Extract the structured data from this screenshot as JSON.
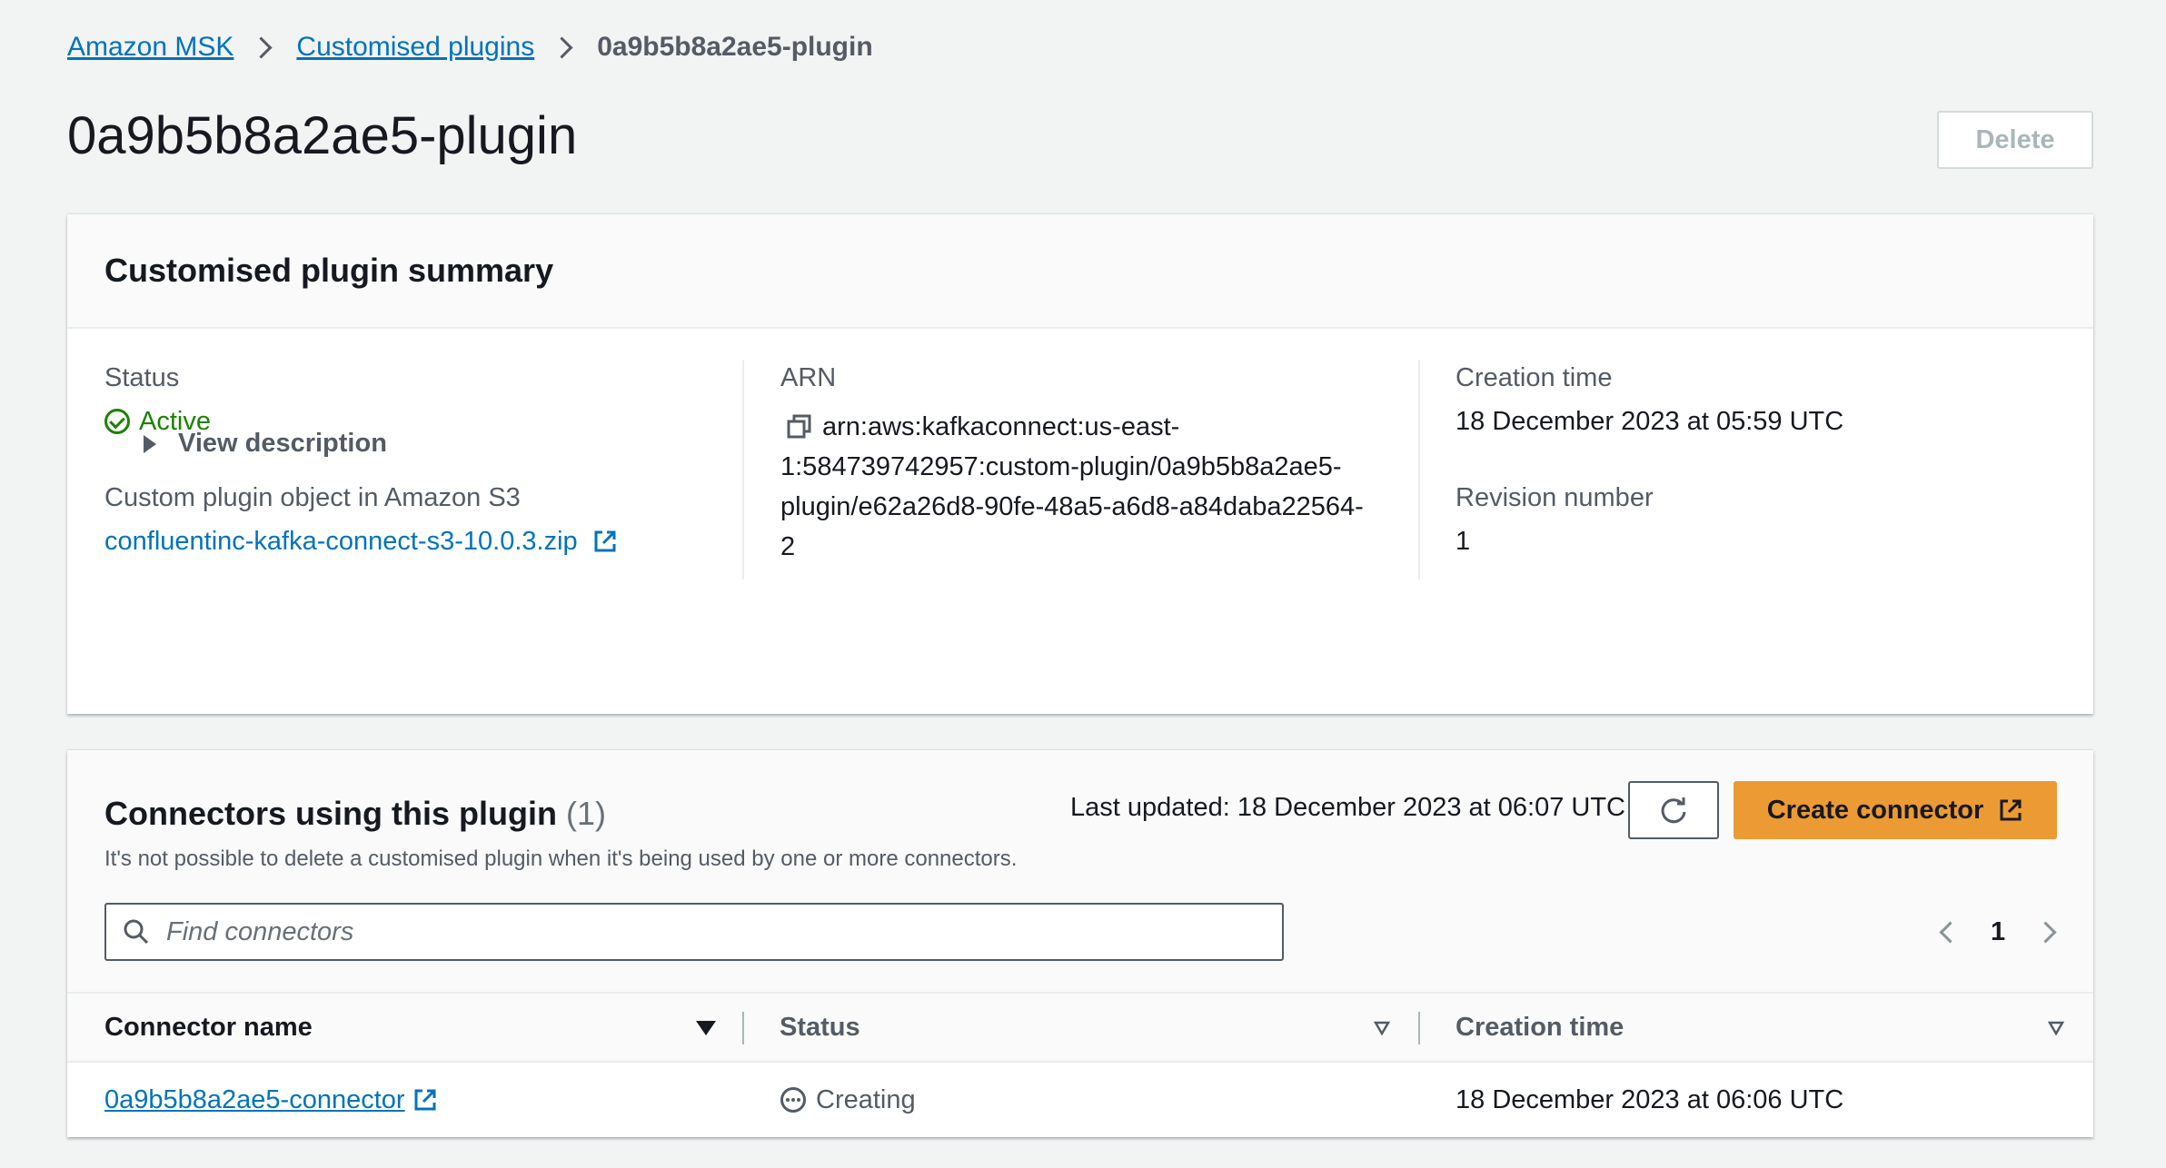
{
  "breadcrumb": {
    "items": [
      "Amazon MSK",
      "Customised plugins"
    ],
    "current": "0a9b5b8a2ae5-plugin"
  },
  "page": {
    "title": "0a9b5b8a2ae5-plugin",
    "delete_label": "Delete"
  },
  "summary": {
    "title": "Customised plugin summary",
    "status_label": "Status",
    "status_value": "Active",
    "s3_label": "Custom plugin object in Amazon S3",
    "s3_link": "confluentinc-kafka-connect-s3-10.0.3.zip",
    "arn_label": "ARN",
    "arn_line1": "arn:aws:kafkaconnect:us-east-",
    "arn_line2": "1:584739742957:custom-plugin/0a9b5b8a2ae5-",
    "arn_line3": "plugin/e62a26d8-90fe-48a5-a6d8-a84daba22564-",
    "arn_line4": "2",
    "creation_label": "Creation time",
    "creation_value": "18 December 2023 at 05:59 UTC",
    "revision_label": "Revision number",
    "revision_value": "1",
    "view_description": "View description"
  },
  "connectors": {
    "title": "Connectors using this plugin",
    "count": "(1)",
    "description": "It's not possible to delete a customised plugin when it's being used by one or more connectors.",
    "last_updated": "Last updated: 18 December 2023 at 06:07 UTC",
    "create_label": "Create connector",
    "search_placeholder": "Find connectors",
    "page": "1",
    "columns": [
      "Connector name",
      "Status",
      "Creation time"
    ],
    "rows": [
      {
        "name": "0a9b5b8a2ae5-connector",
        "status": "Creating",
        "creation_time": "18 December 2023 at 06:06 UTC"
      }
    ]
  },
  "colors": {
    "link": "#0073bb",
    "active": "#1d8102",
    "primary_button": "#eb9a34",
    "background": "#f2f3f3"
  },
  "icons": [
    "chevron-right-icon",
    "check-circle-icon",
    "external-link-icon",
    "copy-icon",
    "caret-right-icon",
    "refresh-icon",
    "search-icon",
    "chevron-left-icon",
    "sort-down-icon",
    "pending-icon"
  ]
}
